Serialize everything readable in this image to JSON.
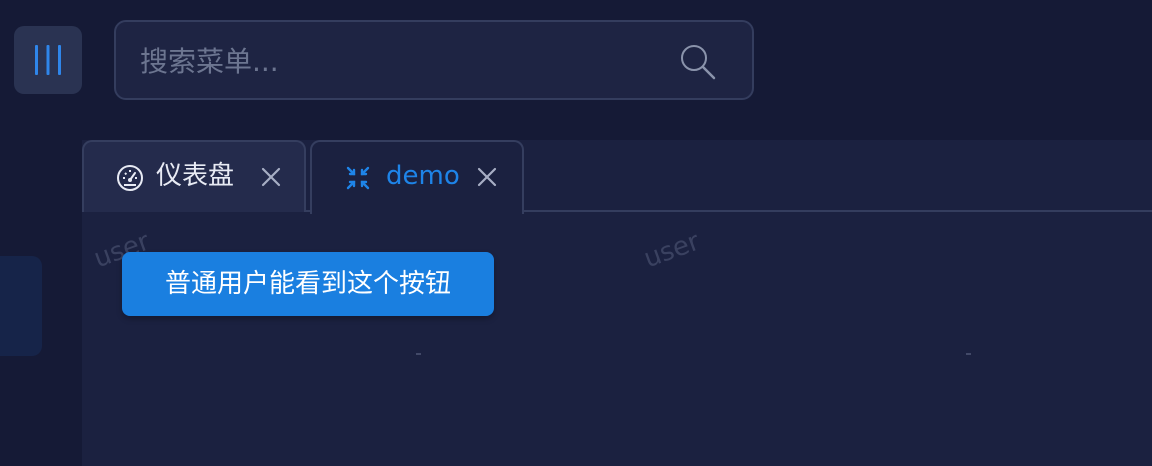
{
  "search": {
    "placeholder": "搜索菜单..."
  },
  "tabs": [
    {
      "label": "仪表盘",
      "icon": "dashboard-icon",
      "active": false
    },
    {
      "label": "demo",
      "icon": "compress-icon",
      "active": true
    }
  ],
  "content": {
    "button_label": "普通用户能看到这个按钮"
  },
  "watermark": {
    "text": "user"
  },
  "colors": {
    "background": "#151a36",
    "panel": "#1b2140",
    "accent": "#1a7fe0",
    "active_tab_text": "#1e84e8"
  }
}
